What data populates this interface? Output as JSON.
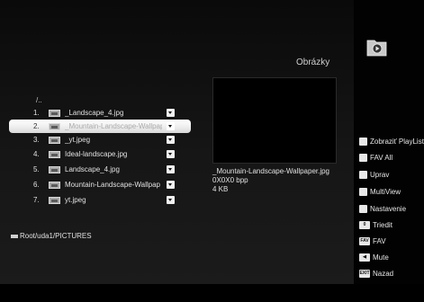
{
  "header": {
    "title": "Obrázky",
    "folder_icon": "folder-play-icon"
  },
  "file_list": {
    "root": "/..",
    "rows": [
      {
        "num": "1.",
        "name": "_Landscape_4.jpg",
        "selected": false
      },
      {
        "num": "2.",
        "name": "_Mountain-Landscape-Wallpaper.jpg",
        "selected": true
      },
      {
        "num": "3.",
        "name": "_yt.jpeg",
        "selected": false
      },
      {
        "num": "4.",
        "name": "Ideal-landscape.jpg",
        "selected": false
      },
      {
        "num": "5.",
        "name": "Landscape_4.jpg",
        "selected": false
      },
      {
        "num": "6.",
        "name": "Mountain-Landscape-Wallpap",
        "selected": false
      },
      {
        "num": "7.",
        "name": "yt.jpeg",
        "selected": false
      }
    ]
  },
  "preview": {
    "filename": "_Mountain-Landscape-Wallpaper.jpg",
    "dimensions": "0X0X0 bpp",
    "size": "4 KB"
  },
  "breadcrumb": {
    "path": "Root/uda1/PICTURES"
  },
  "menu": {
    "items": [
      {
        "icon": "■",
        "label": "Zobraziť PlayList"
      },
      {
        "icon": "■",
        "label": "FAV All"
      },
      {
        "icon": "■",
        "label": "Uprav"
      },
      {
        "icon": "■",
        "label": "MultiView"
      },
      {
        "icon": "■",
        "label": "Nastavenie"
      },
      {
        "icon": "0",
        "label": "Triedit"
      },
      {
        "icon": "FAV",
        "label": "FAV"
      },
      {
        "icon": "◀",
        "label": "Mute"
      },
      {
        "icon": "EXIT",
        "label": "Nazad"
      }
    ]
  }
}
